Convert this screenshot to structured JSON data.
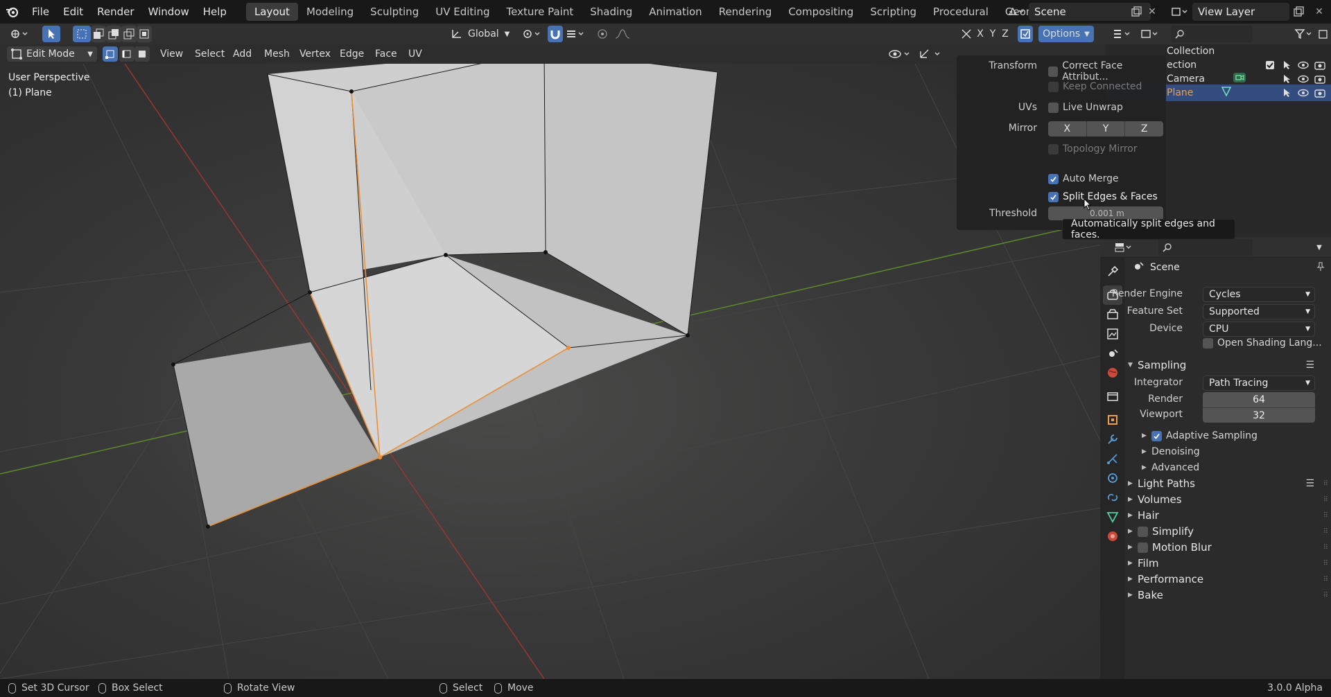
{
  "topbar": {
    "menus": [
      "File",
      "Edit",
      "Render",
      "Window",
      "Help"
    ],
    "workspaces": [
      "Layout",
      "Modeling",
      "Sculpting",
      "UV Editing",
      "Texture Paint",
      "Shading",
      "Animation",
      "Rendering",
      "Compositing",
      "Scripting",
      "Procedural",
      "Geometry Nodes"
    ],
    "active_workspace": "Layout",
    "add_tab": "+",
    "scene": "Scene",
    "view_layer": "View Layer"
  },
  "header2": {
    "orientation": "Global",
    "axes": [
      "X",
      "Y",
      "Z"
    ],
    "options_label": "Options"
  },
  "header3": {
    "mode": "Edit Mode",
    "menus": [
      "View",
      "Select",
      "Add",
      "Mesh",
      "Vertex",
      "Edge",
      "Face",
      "UV"
    ]
  },
  "viewport": {
    "perspective_label": "User Perspective",
    "object_label": "(1) Plane"
  },
  "options_popover": {
    "transform_label": "Transform",
    "correct_face_attr": "Correct Face Attribut...",
    "keep_connected": "Keep Connected",
    "uvs_label": "UVs",
    "live_unwrap": "Live Unwrap",
    "mirror_label": "Mirror",
    "mirror_axes": [
      "X",
      "Y",
      "Z"
    ],
    "topology_mirror": "Topology Mirror",
    "auto_merge": "Auto Merge",
    "split_edges_faces": "Split Edges & Faces",
    "threshold_label": "Threshold",
    "threshold_value": "0.001 m"
  },
  "tooltip": {
    "text": "Automatically split edges and faces."
  },
  "outliner": {
    "items": [
      {
        "label": "Collection"
      },
      {
        "label": "ection"
      },
      {
        "label": "Camera"
      },
      {
        "label": "Plane"
      }
    ]
  },
  "properties": {
    "scene_title": "Scene",
    "render_engine_label": "Render Engine",
    "render_engine": "Cycles",
    "feature_set_label": "Feature Set",
    "feature_set": "Supported",
    "device_label": "Device",
    "device": "CPU",
    "osl_label": "Open Shading Lang...",
    "sampling": "Sampling",
    "integrator_label": "Integrator",
    "integrator": "Path Tracing",
    "render_label": "Render",
    "render_samples": "64",
    "viewport_label": "Viewport",
    "viewport_samples": "32",
    "adaptive_sampling": "Adaptive Sampling",
    "denoising": "Denoising",
    "advanced": "Advanced",
    "light_paths": "Light Paths",
    "volumes": "Volumes",
    "hair": "Hair",
    "simplify": "Simplify",
    "motion_blur": "Motion Blur",
    "film": "Film",
    "performance": "Performance",
    "bake": "Bake"
  },
  "statusbar": {
    "set_cursor": "Set 3D Cursor",
    "box_select": "Box Select",
    "rotate_view": "Rotate View",
    "select": "Select",
    "move": "Move",
    "version": "3.0.0 Alpha"
  },
  "colors": {
    "accent": "#4772b3",
    "selected_edge": "#e8913a",
    "x_axis": "#b83a3a",
    "y_axis": "#6b9a2e"
  }
}
